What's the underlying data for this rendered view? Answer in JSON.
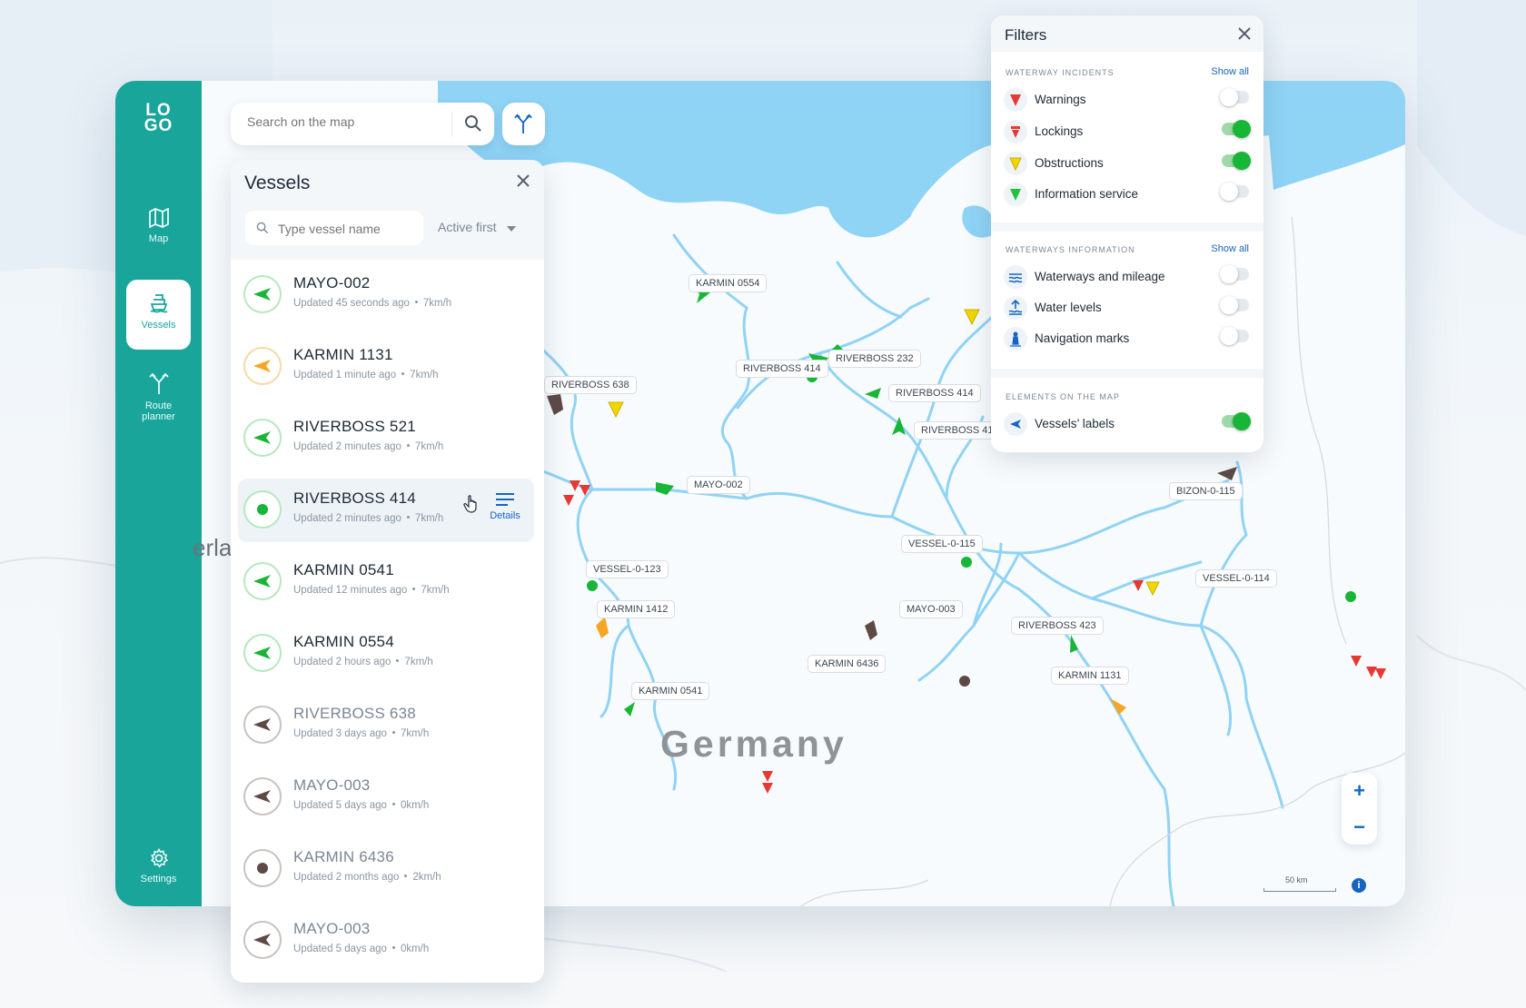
{
  "logo": {
    "line1": "LO",
    "line2": "GO"
  },
  "nav": [
    {
      "label": "Map",
      "icon": "map-icon"
    },
    {
      "label": "Vessels",
      "icon": "ship-icon",
      "active": true
    },
    {
      "label": "Route planner",
      "icon": "route-icon"
    },
    {
      "label": "Settings",
      "icon": "gear-icon"
    }
  ],
  "search": {
    "placeholder": "Search on the map"
  },
  "vessels_panel": {
    "title": "Vessels",
    "search_placeholder": "Type vessel name",
    "sort_label": "Active first",
    "details_label": "Details",
    "items": [
      {
        "name": "MAYO-002",
        "updated": "Updated 45 seconds ago",
        "speed": "7km/h",
        "status": "green",
        "icon": "arrow"
      },
      {
        "name": "KARMIN 1131",
        "updated": "Updated 1 minute ago",
        "speed": "7km/h",
        "status": "orange",
        "icon": "arrow"
      },
      {
        "name": "RIVERBOSS 521",
        "updated": "Updated 2 minutes ago",
        "speed": "7km/h",
        "status": "green",
        "icon": "arrow"
      },
      {
        "name": "RIVERBOSS 414",
        "updated": "Updated 2 minutes ago",
        "speed": "7km/h",
        "status": "green",
        "icon": "dot",
        "highlighted": true
      },
      {
        "name": "KARMIN 0541",
        "updated": "Updated 12 minutes ago",
        "speed": "7km/h",
        "status": "green",
        "icon": "arrow"
      },
      {
        "name": "KARMIN 0554",
        "updated": "Updated 2 hours ago",
        "speed": "7km/h",
        "status": "green",
        "icon": "arrow"
      },
      {
        "name": "RIVERBOSS 638",
        "updated": "Updated 3 days ago",
        "speed": "7km/h",
        "status": "brown",
        "icon": "arrow"
      },
      {
        "name": "MAYO-003",
        "updated": "Updated 5 days ago",
        "speed": "0km/h",
        "status": "brown",
        "icon": "arrow"
      },
      {
        "name": "KARMIN 6436",
        "updated": "Updated 2 months ago",
        "speed": "2km/h",
        "status": "brown",
        "icon": "dot"
      },
      {
        "name": "MAYO-003",
        "updated": "Updated 5 days ago",
        "speed": "0km/h",
        "status": "brown",
        "icon": "arrow"
      }
    ]
  },
  "filters": {
    "title": "Filters",
    "sections": [
      {
        "title": "WATERWAY INCIDENTS",
        "show_all": "Show all",
        "items": [
          {
            "label": "Warnings",
            "on": false,
            "color": "#e53935"
          },
          {
            "label": "Lockings",
            "on": true,
            "color": "#e53935"
          },
          {
            "label": "Obstructions",
            "on": true,
            "color": "#f2d600"
          },
          {
            "label": "Information service",
            "on": false,
            "color": "#22c33a"
          }
        ]
      },
      {
        "title": "WATERWAYS INFORMATION",
        "show_all": "Show all",
        "items": [
          {
            "label": "Waterways and mileage",
            "on": false
          },
          {
            "label": "Water levels",
            "on": false
          },
          {
            "label": "Navigation marks",
            "on": false
          }
        ]
      },
      {
        "title": "ELEMENTS ON THE MAP",
        "items": [
          {
            "label": "Vessels’ labels",
            "on": true
          }
        ]
      }
    ]
  },
  "map": {
    "country": "Germany",
    "country_partial": "erla",
    "scale_label": "50 km",
    "zoom_in": "+",
    "zoom_out": "−",
    "info": "i",
    "labels": [
      "KARMIN 0554",
      "RIVERBOSS 414",
      "RIVERBOSS 232",
      "RIVERBOSS 638",
      "RIVERBOSS 414",
      "RIVERBOSS 41",
      "MAYO-002",
      "BIZON-0-115",
      "VESSEL-0-115",
      "VESSEL-0-123",
      "VESSEL-0-114",
      "KARMIN 1412",
      "MAYO-003",
      "RIVERBOSS 423",
      "KARMIN 6436",
      "KARMIN 1131",
      "KARMIN 0541"
    ]
  },
  "colors": {
    "accent": "#1aa59b",
    "green": "#17b636",
    "orange": "#f5a623",
    "brown": "#5d4a45",
    "link": "#1565c0"
  }
}
